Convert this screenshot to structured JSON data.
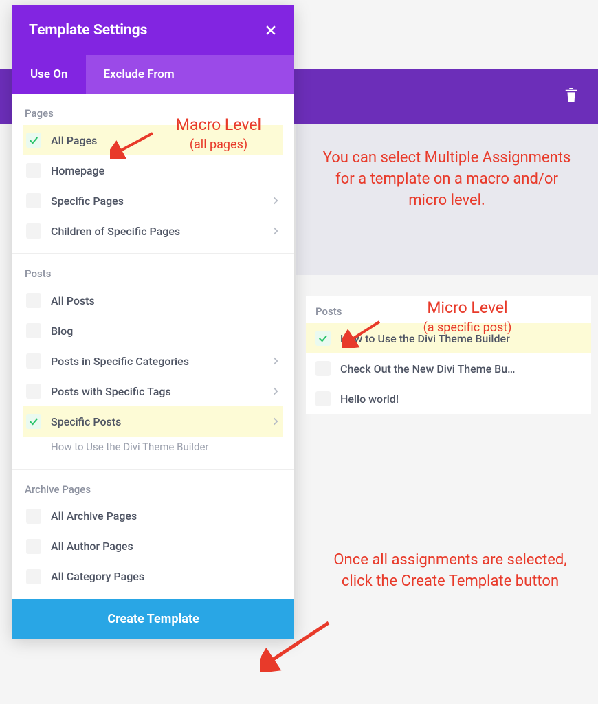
{
  "modal": {
    "title": "Template Settings",
    "tabs": {
      "use_on": "Use On",
      "exclude_from": "Exclude From"
    },
    "sections": {
      "pages": {
        "label": "Pages",
        "all_pages": "All Pages",
        "homepage": "Homepage",
        "specific_pages": "Specific Pages",
        "children_specific": "Children of Specific Pages"
      },
      "posts": {
        "label": "Posts",
        "all_posts": "All Posts",
        "blog": "Blog",
        "cats": "Posts in Specific Categories",
        "tags": "Posts with Specific Tags",
        "specific_posts": "Specific Posts",
        "selected_sub": "How to Use the Divi Theme Builder"
      },
      "archive": {
        "label": "Archive Pages",
        "all_archive": "All Archive Pages",
        "all_author": "All Author Pages",
        "all_category": "All Category Pages"
      }
    },
    "create_button": "Create Template"
  },
  "right_panel": {
    "label": "Posts",
    "items": {
      "a": "How to Use the Divi Theme Builder",
      "b": "Check Out the New Divi Theme Bu…",
      "c": "Hello world!"
    }
  },
  "annotations": {
    "macro_title": "Macro Level",
    "macro_sub": "(all pages)",
    "micro_title": "Micro Level",
    "micro_sub": "(a specific post)",
    "multi": "You can select  Multiple Assignments for a template on a macro and/or micro level.",
    "bottom": "Once all assignments are selected, click the Create Template button"
  }
}
